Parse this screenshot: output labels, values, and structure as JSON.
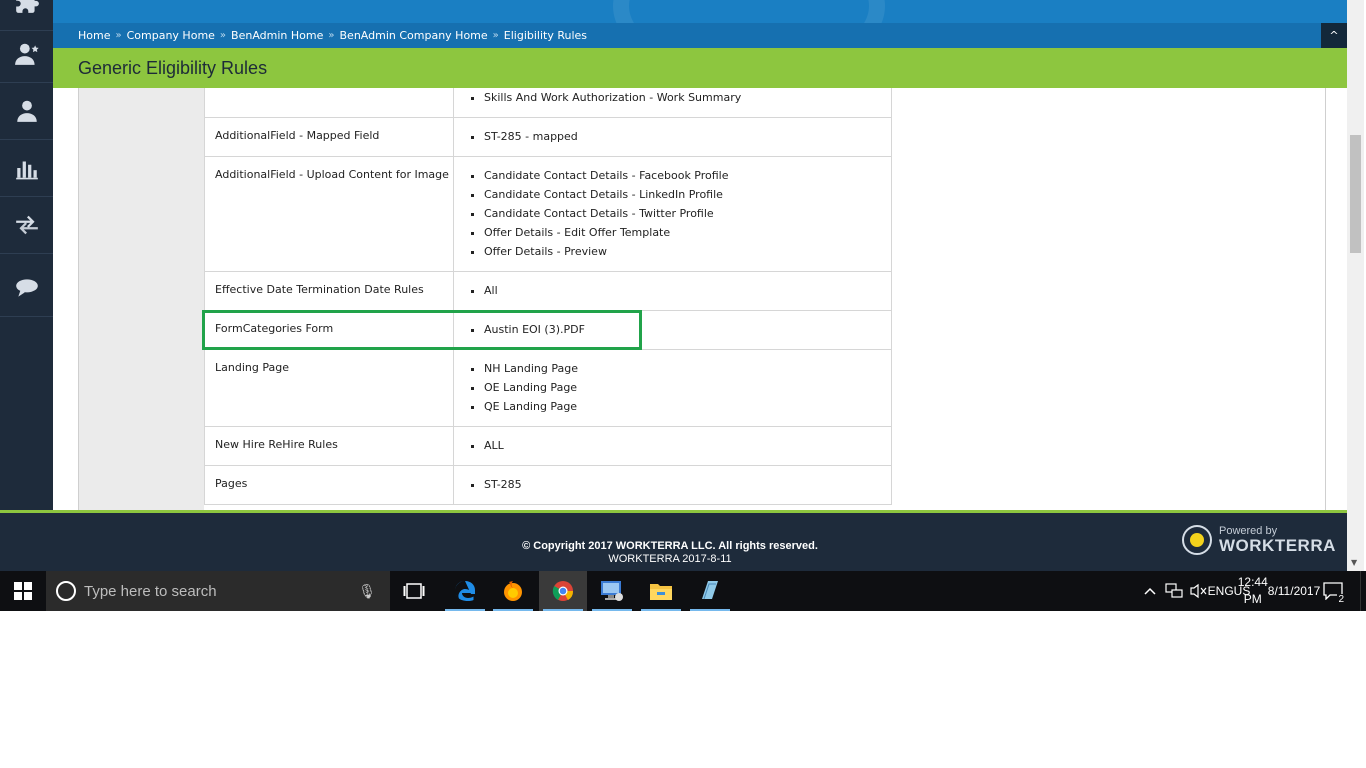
{
  "breadcrumb": [
    "Home",
    "Company Home",
    "BenAdmin Home",
    "BenAdmin Company Home",
    "Eligibility Rules"
  ],
  "breadcrumb_separator": "»",
  "collapse_icon": "^",
  "page_title": "Generic Eligibility Rules",
  "sidebar_icons": [
    "puzzle-icon",
    "user-star-icon",
    "user-icon",
    "bar-chart-icon",
    "transfer-arrows-icon",
    "chat-bubble-icon"
  ],
  "rules": [
    {
      "name": "",
      "values": [
        "Skills And Work Authorization - Work Summary"
      ]
    },
    {
      "name": "AdditionalField - Mapped Field",
      "values": [
        "ST-285 - mapped"
      ]
    },
    {
      "name": "AdditionalField - Upload Content for Image",
      "values": [
        "Candidate Contact Details - Facebook Profile",
        "Candidate Contact Details - LinkedIn Profile",
        "Candidate Contact Details - Twitter Profile",
        "Offer Details - Edit Offer Template",
        "Offer Details - Preview"
      ]
    },
    {
      "name": "Effective Date Termination Date Rules",
      "values": [
        "All"
      ]
    },
    {
      "name": "FormCategories Form",
      "values": [
        "Austin EOI (3).PDF"
      ]
    },
    {
      "name": "Landing Page",
      "values": [
        "NH Landing Page",
        "OE Landing Page",
        "QE Landing Page"
      ]
    },
    {
      "name": "New Hire ReHire Rules",
      "values": [
        "ALL"
      ]
    },
    {
      "name": "Pages",
      "values": [
        "ST-285"
      ]
    }
  ],
  "highlight_color": "#21a34a",
  "footer": {
    "copyright": "© Copyright 2017 WORKTERRA LLC. All rights reserved.",
    "version": "WORKTERRA 2017-8-11",
    "powered_by": "Powered by",
    "brand": "WORKTERRA"
  },
  "taskbar": {
    "search_placeholder": "Type here to search",
    "apps": [
      "task-view-icon",
      "edge-icon",
      "firefox-icon",
      "chrome-icon",
      "remote-desktop-icon",
      "file-explorer-icon",
      "notepad-icon"
    ],
    "lang_top": "ENG",
    "lang_bottom": "US",
    "time": "12:44 PM",
    "date": "8/11/2017",
    "notification_count": "2"
  },
  "colors": {
    "sidebar": "#1e2b3b",
    "top_blue": "#1a7fc3",
    "title_green": "#8dc63f"
  }
}
